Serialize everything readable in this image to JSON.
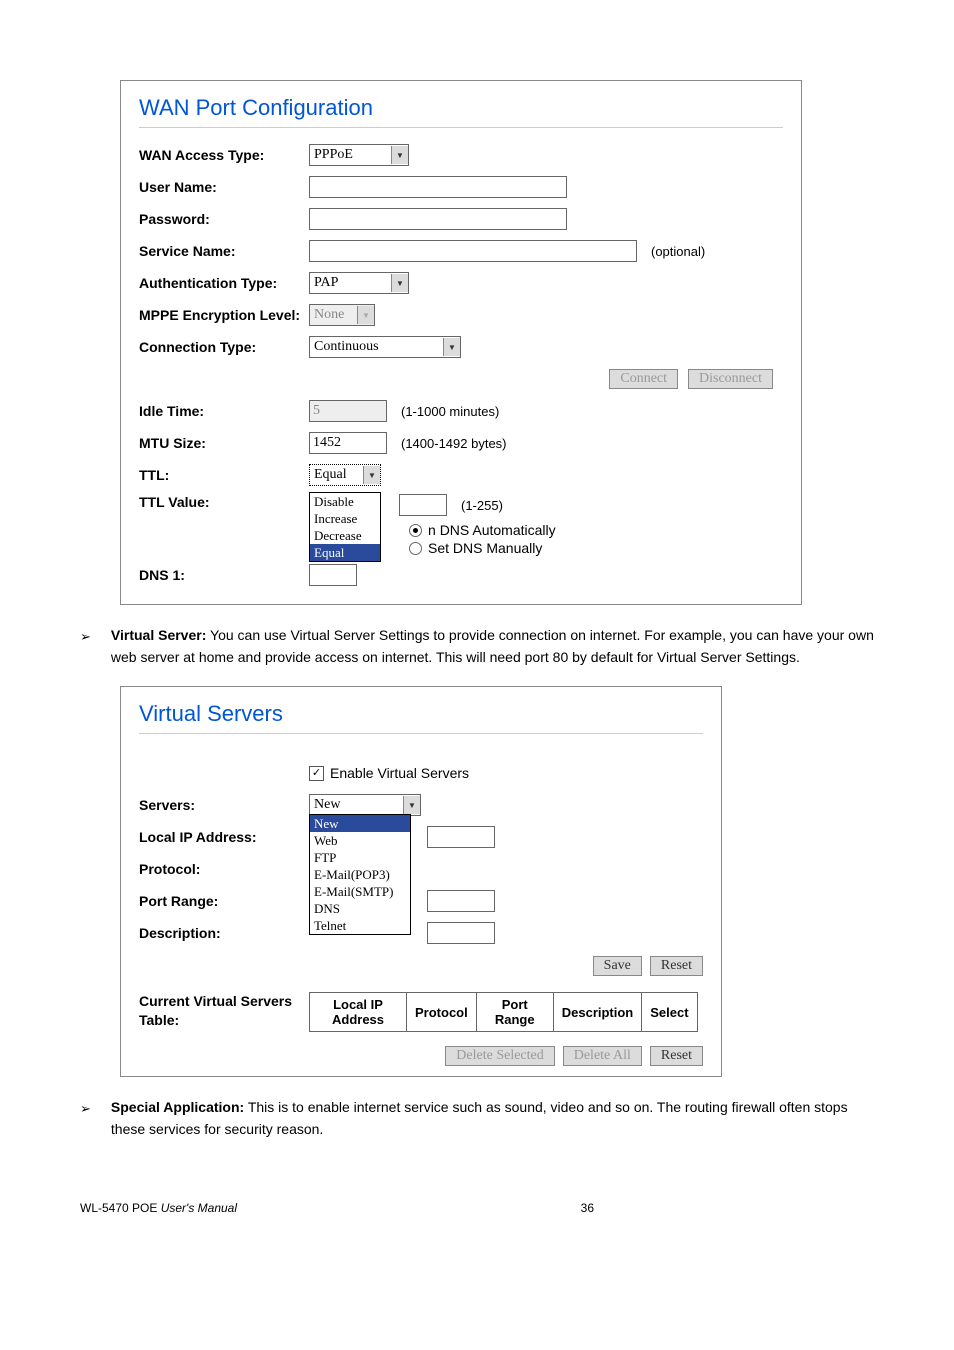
{
  "wan_panel": {
    "title": "WAN Port Configuration",
    "access_type_label": "WAN Access Type:",
    "access_type_value": "PPPoE",
    "user_name_label": "User Name:",
    "user_name_value": "",
    "password_label": "Password:",
    "password_value": "",
    "service_name_label": "Service Name:",
    "service_name_value": "",
    "service_name_hint": "(optional)",
    "auth_type_label": "Authentication Type:",
    "auth_type_value": "PAP",
    "mppe_label": "MPPE Encryption Level:",
    "mppe_value": "None",
    "conn_type_label": "Connection Type:",
    "conn_type_value": "Continuous",
    "connect_btn": "Connect",
    "disconnect_btn": "Disconnect",
    "idle_time_label": "Idle Time:",
    "idle_time_value": "5",
    "idle_time_hint": "(1-1000 minutes)",
    "mtu_label": "MTU Size:",
    "mtu_value": "1452",
    "mtu_hint": "(1400-1492 bytes)",
    "ttl_label": "TTL:",
    "ttl_value": "Equal",
    "ttl_options": [
      "Disable",
      "Increase",
      "Decrease",
      "Equal"
    ],
    "ttl_selected_index": 3,
    "ttl_value_label": "TTL Value:",
    "ttl_value_input": "",
    "ttl_value_hint": "(1-255)",
    "dns_auto_label": "DNS Automatically",
    "dns_manual_label": "Set DNS Manually",
    "dns_heading": "DNS 1:"
  },
  "para_vs": {
    "heading": "Virtual Server:",
    "body": " You can use Virtual Server Settings to provide connection on internet. For example, you can have your own web server at home and provide access on internet. This will need port 80 by default for Virtual Server Settings."
  },
  "vs_panel": {
    "title": "Virtual Servers",
    "enable_label": "Enable Virtual Servers",
    "enable_checked": true,
    "servers_label": "Servers:",
    "servers_value": "New",
    "servers_options": [
      "New",
      "Web",
      "FTP",
      "E-Mail(POP3)",
      "E-Mail(SMTP)",
      "DNS",
      "Telnet"
    ],
    "servers_selected_index": 0,
    "local_ip_label": "Local IP Address:",
    "protocol_label": "Protocol:",
    "port_range_label": "Port Range:",
    "description_label": "Description:",
    "save_btn": "Save",
    "reset_btn": "Reset",
    "table_title": "Current Virtual Servers Table:",
    "col_local_ip": "Local IP Address",
    "col_protocol": "Protocol",
    "col_port_range": "Port Range",
    "col_description": "Description",
    "col_select": "Select",
    "delete_selected_btn": "Delete Selected",
    "delete_all_btn": "Delete All",
    "reset2_btn": "Reset"
  },
  "para_sa": {
    "heading": "Special Application:",
    "body": " This is to enable internet service such as sound, video and so on. The routing firewall often stops these services for security reason."
  },
  "footer": {
    "model": "WL-5470 POE ",
    "um": "User's Manual",
    "page": "36"
  }
}
